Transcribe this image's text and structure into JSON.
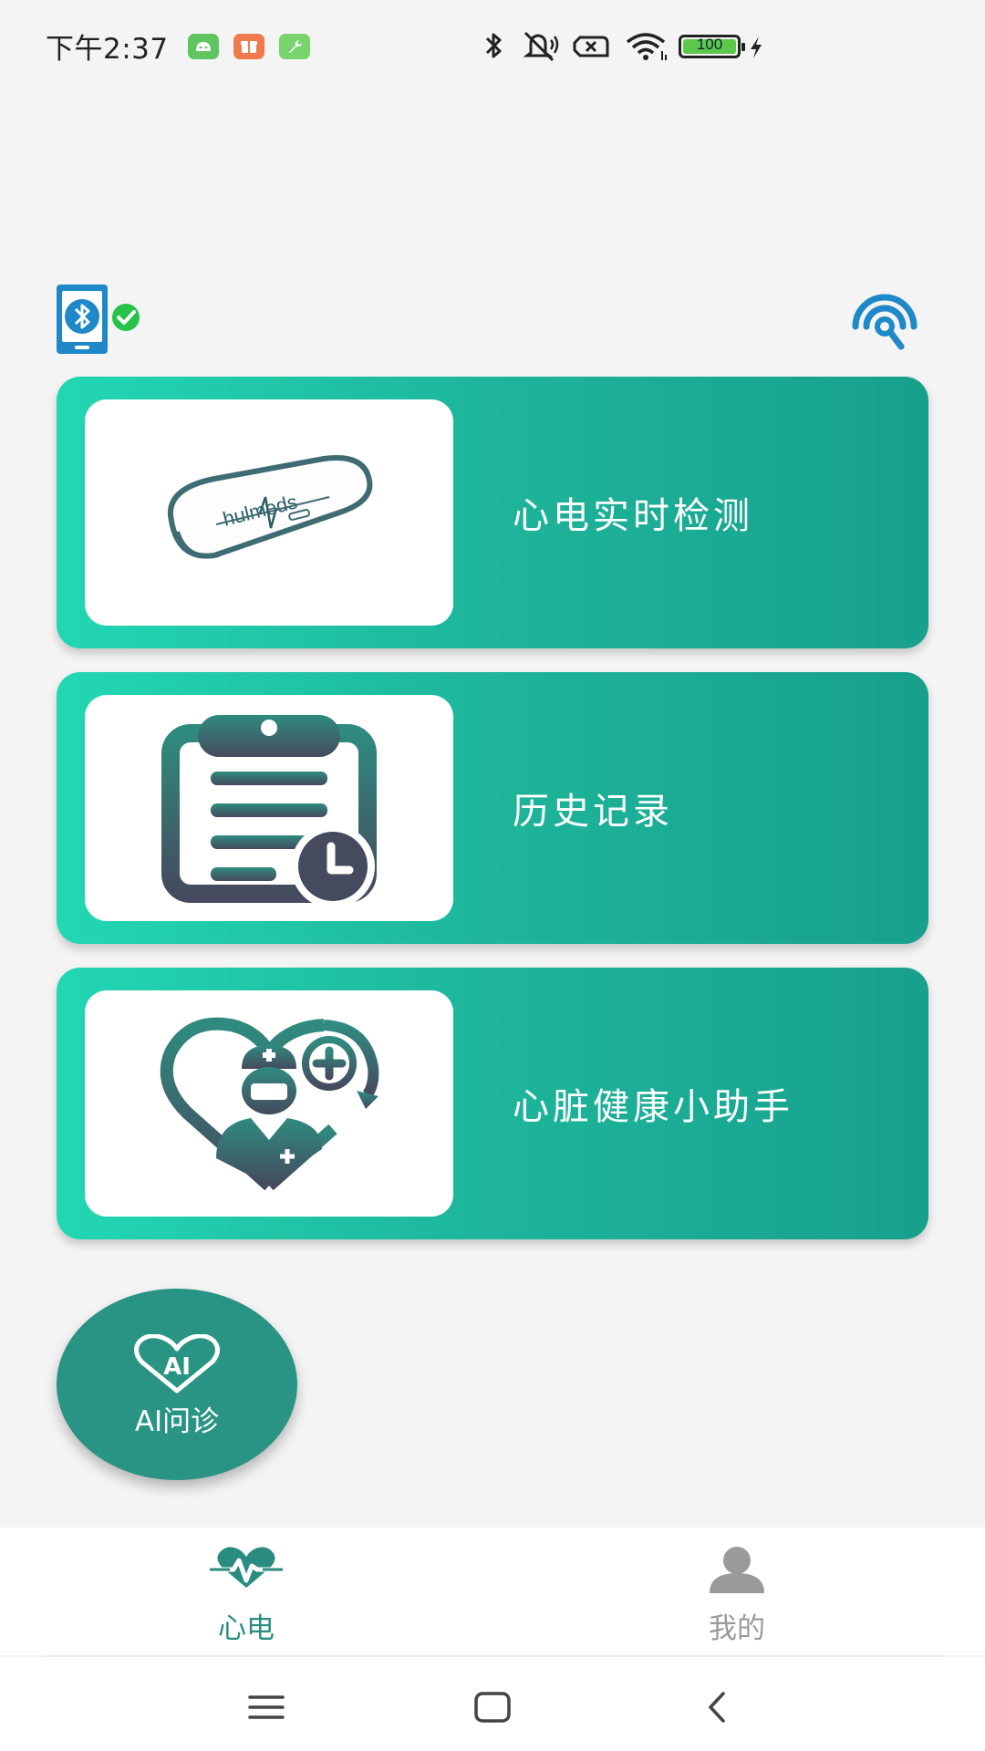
{
  "status_bar": {
    "time": "下午2:37",
    "battery": "100",
    "notification_icons": [
      "android-icon",
      "gift-icon",
      "wrench-icon"
    ],
    "status_icons": [
      "bluetooth-icon",
      "mute-icon",
      "sim-off-icon",
      "wifi-icon",
      "battery-icon",
      "charging-icon"
    ]
  },
  "toolbar": {
    "bt_device_status": "connected",
    "nfc_icon": "nfc-icon"
  },
  "cards": [
    {
      "label": "心电实时检测",
      "icon": "ecg-device-icon",
      "device_brand": "hulmeds"
    },
    {
      "label": "历史记录",
      "icon": "clipboard-history-icon"
    },
    {
      "label": "心脏健康小助手",
      "icon": "doctor-heart-icon"
    }
  ],
  "ai_button": {
    "label": "AI问诊",
    "icon_text": "AI"
  },
  "bottom_nav": {
    "tabs": [
      {
        "label": "心电",
        "icon": "heart-pulse-icon",
        "active": true
      },
      {
        "label": "我的",
        "icon": "person-icon",
        "active": false
      }
    ]
  },
  "colors": {
    "accent": "#2a9484",
    "card_gradient_start": "#22d7b4",
    "card_gradient_end": "#17a08c",
    "active_tab": "#2a8c80",
    "inactive_tab": "#9a9a9a",
    "icon_dark": "#3d5b6a"
  }
}
